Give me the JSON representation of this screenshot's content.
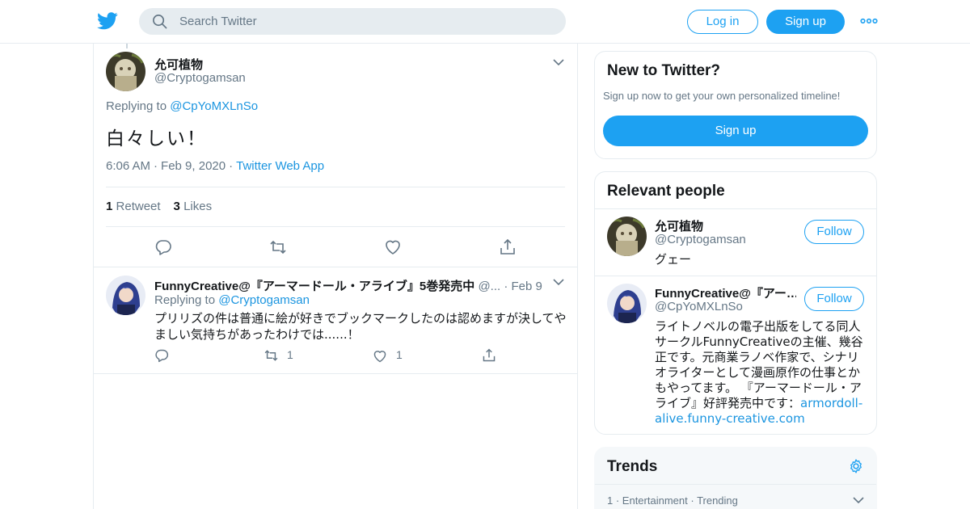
{
  "header": {
    "search_placeholder": "Search Twitter",
    "login_label": "Log in",
    "signup_label": "Sign up",
    "brand_color": "#1da1f2"
  },
  "tweet": {
    "name": "允可植物",
    "handle": "@Cryptogamsan",
    "replying_prefix": "Replying to ",
    "replying_to": "@CpYoMXLnSo",
    "text": "白々しい！",
    "time": "6:06 AM",
    "date": "Feb 9, 2020",
    "source": "Twitter Web App",
    "retweets_count": "1",
    "retweets_label": "Retweet",
    "likes_count": "3",
    "likes_label": "Likes"
  },
  "reply": {
    "name": "FunnyCreative@『アーマードール・アライブ』5巻発売中",
    "handle": "@...",
    "time": "Feb 9",
    "replying_prefix": "Replying to ",
    "replying_to": "@Cryptogamsan",
    "text": "プリリズの件は普通に絵が好きでブックマークしたのは認めますが決してやましい気持ちがあったわけでは......！",
    "retweet_count": "1",
    "like_count": "1"
  },
  "sidebar": {
    "new_to_twitter": {
      "title": "New to Twitter?",
      "subtitle": "Sign up now to get your own personalized timeline!",
      "signup_label": "Sign up"
    },
    "relevant_people": {
      "title": "Relevant people",
      "follow_label": "Follow",
      "people": [
        {
          "name": "允可植物",
          "handle": "@Cryptogamsan",
          "bio": "グェー"
        },
        {
          "name": "FunnyCreative@『アー…",
          "handle": "@CpYoMXLnSo",
          "bio": "ライトノベルの電子出版をしてる同人サークルFunnyCreativeの主催、幾谷正です。元商業ラノベ作家で、シナリオライターとして漫画原作の仕事とかもやってます。 『アーマードール・アライブ』好評発売中です：",
          "link": "armordoll-alive.funny-creative.com"
        }
      ]
    },
    "trends": {
      "title": "Trends",
      "first_rank": "1",
      "first_category": "Entertainment",
      "first_status": "Trending"
    }
  }
}
